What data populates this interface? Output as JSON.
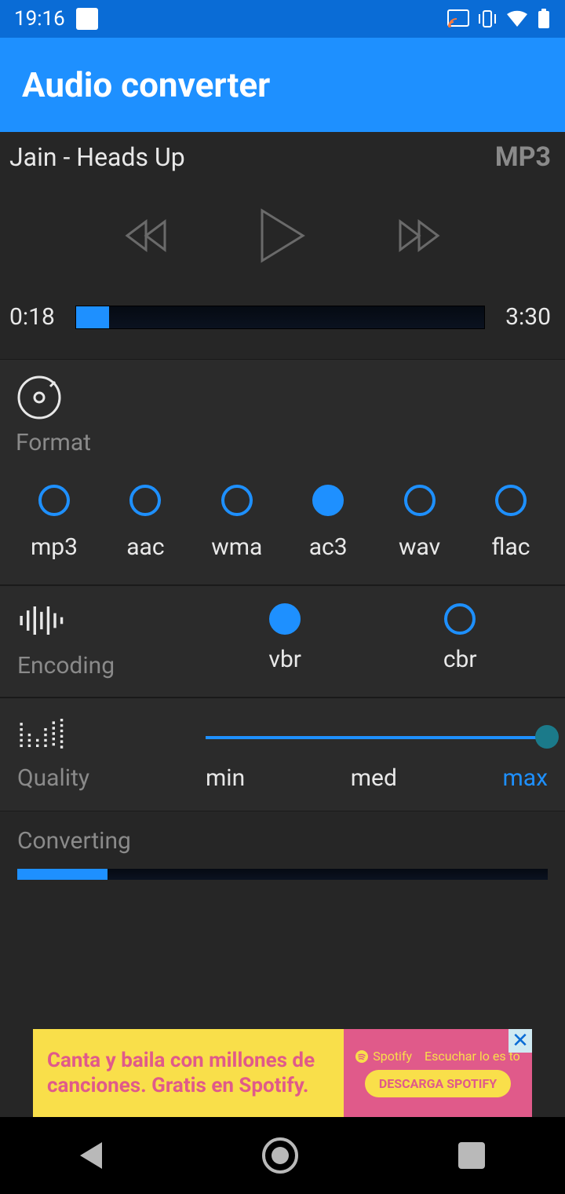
{
  "status": {
    "time": "19:16"
  },
  "app": {
    "title": "Audio converter"
  },
  "player": {
    "track": "Jain - Heads Up",
    "badge": "MP3",
    "elapsed": "0:18",
    "total": "3:30",
    "progress_pct": 8
  },
  "format": {
    "label": "Format",
    "options": [
      "mp3",
      "aac",
      "wma",
      "ac3",
      "wav",
      "flac"
    ],
    "selected": "ac3"
  },
  "encoding": {
    "label": "Encoding",
    "options": [
      "vbr",
      "cbr"
    ],
    "selected": "vbr"
  },
  "quality": {
    "label": "Quality",
    "labels": [
      "min",
      "med",
      "max"
    ],
    "selected": "max"
  },
  "converting": {
    "label": "Converting",
    "progress_pct": 17
  },
  "ad": {
    "line1": "Canta y baila con millones de",
    "line2": "canciones. Gratis en Spotify.",
    "brand": "Spotify",
    "tag": "Escuchar lo es to",
    "cta": "DESCARGA SPOTIFY"
  },
  "colors": {
    "accent": "#1e90ff"
  }
}
